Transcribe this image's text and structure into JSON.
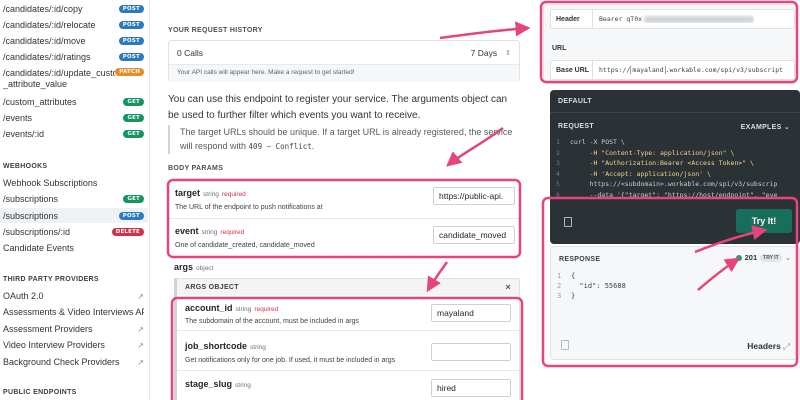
{
  "sidebar": {
    "items": [
      {
        "label": "/candidates/:id/copy",
        "method": "POST"
      },
      {
        "label": "/candidates/:id/relocate",
        "method": "POST"
      },
      {
        "label": "/candidates/:id/move",
        "method": "POST"
      },
      {
        "label": "/candidates/:id/ratings",
        "method": "POST"
      },
      {
        "label": "/candidates/:id/update_custom _attribute_value",
        "method": "PATCH"
      },
      {
        "label": "/custom_attributes",
        "method": "GET"
      },
      {
        "label": "/events",
        "method": "GET"
      },
      {
        "label": "/events/:id",
        "method": "GET"
      }
    ],
    "webhooks_heading": "WEBHOOKS",
    "webhooks": [
      {
        "label": "Webhook Subscriptions",
        "method": ""
      },
      {
        "label": "/subscriptions",
        "method": "GET"
      },
      {
        "label": "/subscriptions",
        "method": "POST"
      },
      {
        "label": "/subscriptions/:id",
        "method": "DELETE"
      },
      {
        "label": "Candidate Events",
        "method": ""
      }
    ],
    "third_party_heading": "THIRD PARTY PROVIDERS",
    "third_party": [
      {
        "label": "OAuth 2.0"
      },
      {
        "label": "Assessments & Video Interviews API"
      },
      {
        "label": "Assessment Providers"
      },
      {
        "label": "Video Interview Providers"
      },
      {
        "label": "Background Check Providers"
      }
    ],
    "public_heading": "PUBLIC ENDPOINTS"
  },
  "history": {
    "title": "YOUR REQUEST HISTORY",
    "calls": "0 Calls",
    "range": "7 Days",
    "note": "Your API calls will appear here. Make a request to get started!"
  },
  "description": "You can use this endpoint to register your service. The arguments object can be used to further filter which events you want to receive.",
  "note_text": "The target URLs should be unique. If a target URL is already registered, the service will respond with",
  "note_code": "409 – Conflict",
  "body_params": {
    "title": "BODY PARAMS",
    "params": [
      {
        "name": "target",
        "type": "string",
        "required": "required",
        "desc": "The URL of the endpoint to push notifications at",
        "value": "https://public-api."
      },
      {
        "name": "event",
        "type": "string",
        "required": "required",
        "desc": "One of candidate_created, candidate_moved",
        "value": "candidate_moved"
      }
    ],
    "args_label": "args",
    "args_type": "object",
    "args_object": "ARGS OBJECT",
    "args": [
      {
        "name": "account_id",
        "type": "string",
        "required": "required",
        "desc": "The subdomain of the account, must be included in args",
        "value": "mayaland"
      },
      {
        "name": "job_shortcode",
        "type": "string",
        "required": "",
        "desc": "Get notifications only for one job. If used, it must be included in args",
        "value": ""
      },
      {
        "name": "stage_slug",
        "type": "string",
        "required": "",
        "desc": "",
        "value": "hired"
      }
    ]
  },
  "auth": {
    "header_key": "Header",
    "header_value": "Bearer qT0x",
    "url_label": "URL",
    "base_url_key": "Base URL",
    "base_url_prefix": "https://",
    "base_url_sub": "mayaland",
    "base_url_suffix": ".workable.com/spi/v3/subscript"
  },
  "code_panel": {
    "default_label": "DEFAULT",
    "request_label": "REQUEST",
    "examples_label": "EXAMPLES",
    "lines": [
      "curl -X POST \\",
      "     -H \"Content-Type: application/json\" \\",
      "     -H \"Authorization:Bearer <Access Token>\" \\",
      "     -H 'Accept: application/json' \\",
      "     https://<subdomain>.workable.com/spi/v3/subscrip",
      "     --data '{\"target\": \"https://host/endpoint\", \"eve"
    ],
    "try_label": "Try It!"
  },
  "response": {
    "label": "RESPONSE",
    "status": "201",
    "tag": "TRY IT",
    "lines": [
      "{",
      "  \"id\": 55688",
      "}"
    ],
    "headers_label": "Headers"
  },
  "colors": {
    "accent": "#176e5b",
    "annotation": "#e5457a",
    "post": "#2d79c4",
    "get": "#16935f",
    "patch": "#e88c2a",
    "delete": "#d1304a"
  }
}
